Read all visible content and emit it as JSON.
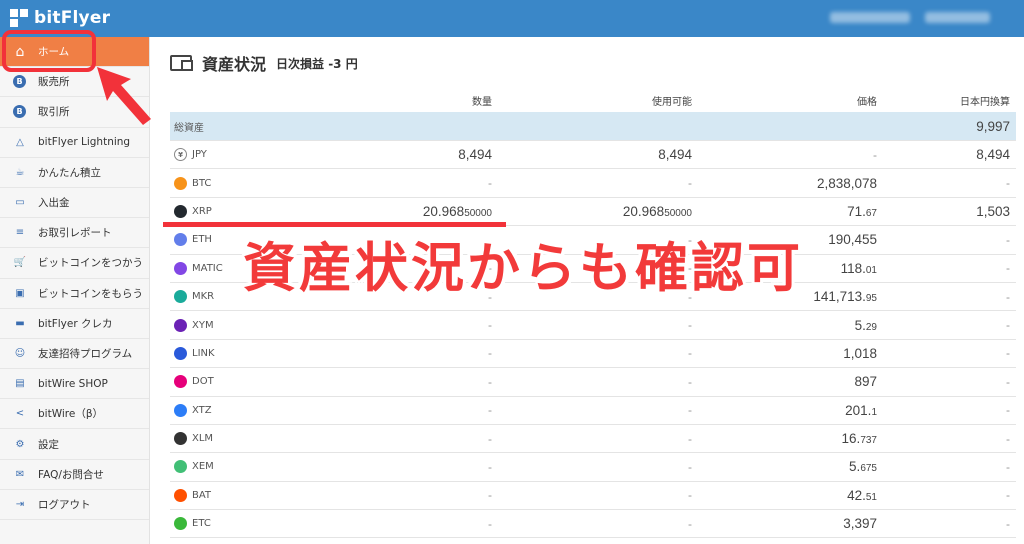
{
  "app": {
    "logo_text": "bitFlyer"
  },
  "sidebar": {
    "items": [
      {
        "label": "ホーム",
        "icon": "home-icon"
      },
      {
        "label": "販売所",
        "icon": "bitcoin-icon"
      },
      {
        "label": "取引所",
        "icon": "bitcoin-icon"
      },
      {
        "label": "bitFlyer Lightning",
        "icon": "lightning-icon"
      },
      {
        "label": "かんたん積立",
        "icon": "piggy-bank-icon"
      },
      {
        "label": "入出金",
        "icon": "cash-icon"
      },
      {
        "label": "お取引レポート",
        "icon": "report-icon"
      },
      {
        "label": "ビットコインをつかう",
        "icon": "cart-icon"
      },
      {
        "label": "ビットコインをもらう",
        "icon": "gift-icon"
      },
      {
        "label": "bitFlyer クレカ",
        "icon": "credit-card-icon"
      },
      {
        "label": "友達招待プログラム",
        "icon": "invite-icon"
      },
      {
        "label": "bitWire SHOP",
        "icon": "shop-icon"
      },
      {
        "label": "bitWire（β）",
        "icon": "share-icon"
      },
      {
        "label": "設定",
        "icon": "gear-icon"
      },
      {
        "label": "FAQ/お問合せ",
        "icon": "mail-icon"
      },
      {
        "label": "ログアウト",
        "icon": "logout-icon"
      }
    ]
  },
  "main": {
    "title": "資産状況",
    "daily_pnl": "日次損益 -3 円"
  },
  "table": {
    "headers": [
      "数量",
      "使用可能",
      "価格",
      "日本円換算"
    ],
    "total": {
      "label": "総資産",
      "value": "9,997"
    },
    "rows": [
      {
        "symbol": "JPY",
        "color": "#ffffff",
        "qty": "8,494",
        "qty_small": "",
        "avail": "8,494",
        "avail_small": "",
        "price": "-",
        "price_small": "",
        "jpy": "8,494"
      },
      {
        "symbol": "BTC",
        "color": "#f7931a",
        "qty": "-",
        "qty_small": "",
        "avail": "-",
        "avail_small": "",
        "price": "2,838,078",
        "price_small": "",
        "jpy": "-"
      },
      {
        "symbol": "XRP",
        "color": "#23292f",
        "qty": "20.968",
        "qty_small": "50000",
        "avail": "20.968",
        "avail_small": "50000",
        "price": "71.",
        "price_small": "67",
        "jpy": "1,503"
      },
      {
        "symbol": "ETH",
        "color": "#627eea",
        "qty": "-",
        "qty_small": "",
        "avail": "-",
        "avail_small": "",
        "price": "190,455",
        "price_small": "",
        "jpy": "-"
      },
      {
        "symbol": "MATIC",
        "color": "#8247e5",
        "qty": "-",
        "qty_small": "",
        "avail": "-",
        "avail_small": "",
        "price": "118.",
        "price_small": "01",
        "jpy": "-"
      },
      {
        "symbol": "MKR",
        "color": "#1aab9b",
        "qty": "-",
        "qty_small": "",
        "avail": "-",
        "avail_small": "",
        "price": "141,713.",
        "price_small": "95",
        "jpy": "-"
      },
      {
        "symbol": "XYM",
        "color": "#6b22b5",
        "qty": "-",
        "qty_small": "",
        "avail": "-",
        "avail_small": "",
        "price": "5.",
        "price_small": "29",
        "jpy": "-"
      },
      {
        "symbol": "LINK",
        "color": "#2a5ada",
        "qty": "-",
        "qty_small": "",
        "avail": "-",
        "avail_small": "",
        "price": "1,018",
        "price_small": "",
        "jpy": "-"
      },
      {
        "symbol": "DOT",
        "color": "#e6007a",
        "qty": "-",
        "qty_small": "",
        "avail": "-",
        "avail_small": "",
        "price": "897",
        "price_small": "",
        "jpy": "-"
      },
      {
        "symbol": "XTZ",
        "color": "#2c7df7",
        "qty": "-",
        "qty_small": "",
        "avail": "-",
        "avail_small": "",
        "price": "201.",
        "price_small": "1",
        "jpy": "-"
      },
      {
        "symbol": "XLM",
        "color": "#333333",
        "qty": "-",
        "qty_small": "",
        "avail": "-",
        "avail_small": "",
        "price": "16.",
        "price_small": "737",
        "jpy": "-"
      },
      {
        "symbol": "XEM",
        "color": "#41bf76",
        "qty": "-",
        "qty_small": "",
        "avail": "-",
        "avail_small": "",
        "price": "5.",
        "price_small": "675",
        "jpy": "-"
      },
      {
        "symbol": "BAT",
        "color": "#ff5000",
        "qty": "-",
        "qty_small": "",
        "avail": "-",
        "avail_small": "",
        "price": "42.",
        "price_small": "51",
        "jpy": "-"
      },
      {
        "symbol": "ETC",
        "color": "#3ab83a",
        "qty": "-",
        "qty_small": "",
        "avail": "-",
        "avail_small": "",
        "price": "3,397",
        "price_small": "",
        "jpy": "-"
      }
    ]
  },
  "annotation": {
    "text": "資産状況からも確認可",
    "color": "#f2323a"
  }
}
